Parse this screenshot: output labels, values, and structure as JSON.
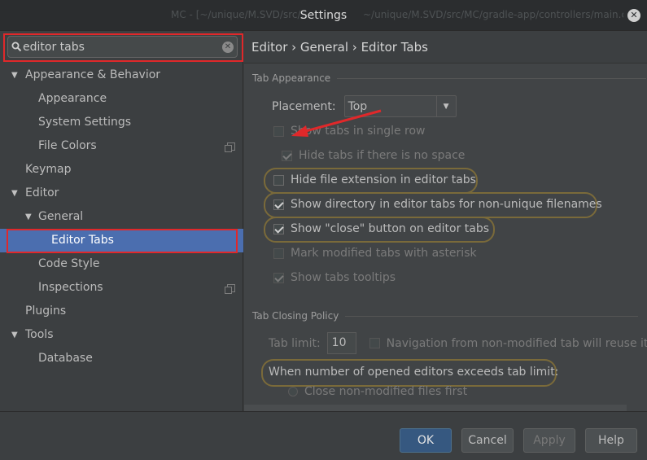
{
  "window": {
    "title": "Settings",
    "ghost_left": "MC - [~/unique/M.SVD/src/...",
    "ghost_right": "~/unique/M.SVD/src/MC/gradle-app/controllers/main.cs"
  },
  "search": {
    "value": "editor tabs"
  },
  "sidebar": {
    "items": [
      {
        "label": "Appearance & Behavior",
        "level": 0,
        "arrow": "▼"
      },
      {
        "label": "Appearance",
        "level": 1
      },
      {
        "label": "System Settings",
        "level": 1
      },
      {
        "label": "File Colors",
        "level": 1
      },
      {
        "label": "Keymap",
        "level": 0
      },
      {
        "label": "Editor",
        "level": 0,
        "arrow": "▼"
      },
      {
        "label": "General",
        "level": 1,
        "arrow": "▼"
      },
      {
        "label": "Editor Tabs",
        "level": 2,
        "selected": true
      },
      {
        "label": "Code Style",
        "level": 1
      },
      {
        "label": "Inspections",
        "level": 1
      },
      {
        "label": "Plugins",
        "level": 0
      },
      {
        "label": "Tools",
        "level": 0,
        "arrow": "▼"
      },
      {
        "label": "Database",
        "level": 1
      }
    ]
  },
  "breadcrumb": "Editor › General › Editor Tabs",
  "tab_appearance": {
    "title": "Tab Appearance",
    "placement_label": "Placement:",
    "placement_value": "Top",
    "options": [
      {
        "label": "Show tabs in single row",
        "checked": false,
        "disabled": false
      },
      {
        "label": "Hide tabs if there is no space",
        "checked": true,
        "disabled": true
      },
      {
        "label": "Hide file extension in editor tabs",
        "checked": false,
        "disabled": false
      },
      {
        "label": "Show directory in editor tabs for non-unique filenames",
        "checked": true,
        "disabled": false
      },
      {
        "label": "Show \"close\" button on editor tabs",
        "checked": true,
        "disabled": false
      },
      {
        "label": "Mark modified tabs with asterisk",
        "checked": false,
        "disabled": false
      },
      {
        "label": "Show tabs tooltips",
        "checked": true,
        "disabled": false
      }
    ]
  },
  "tab_closing": {
    "title": "Tab Closing Policy",
    "limit_label": "Tab limit:",
    "limit_value": "10",
    "nav_label": "Navigation from non-modified tab will reuse it",
    "nav_checked": false,
    "exceed_label": "When number of opened editors exceeds tab limit:",
    "close_label": "Close non-modified files first"
  },
  "buttons": {
    "ok": "OK",
    "cancel": "Cancel",
    "apply": "Apply",
    "help": "Help"
  },
  "colors": {
    "accent": "#4b6eaf",
    "annotation_red": "#e0282a",
    "highlight": "#7a6a3a"
  }
}
